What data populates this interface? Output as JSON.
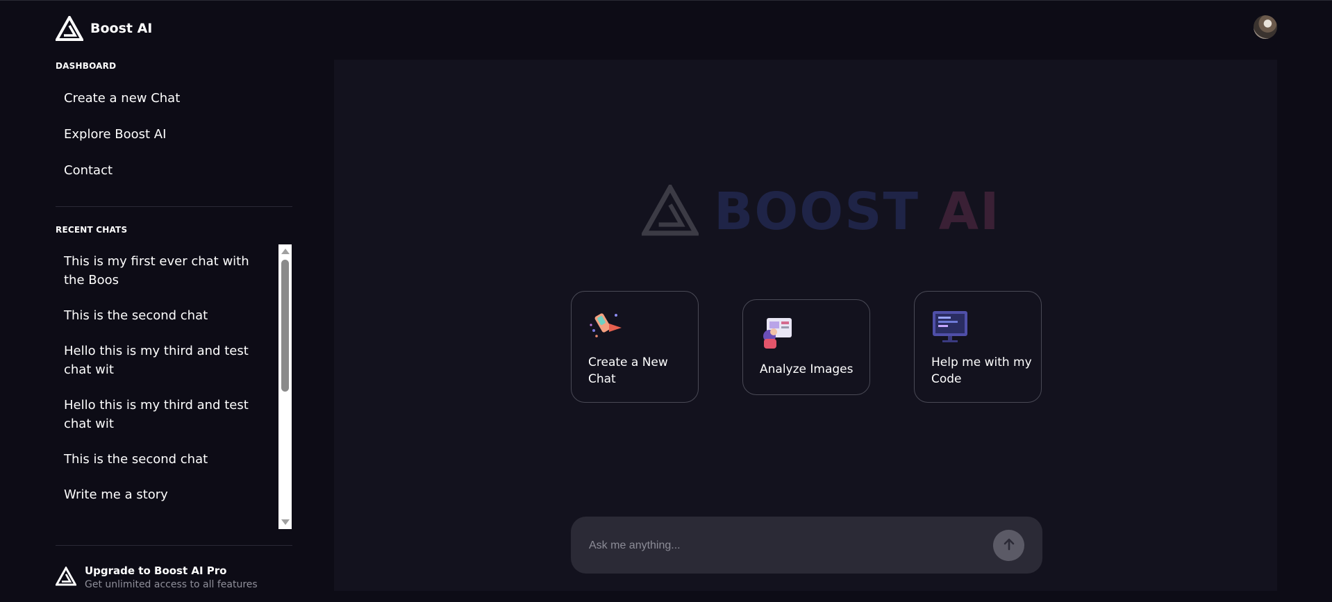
{
  "app": {
    "title": "Boost AI",
    "logo_icon": "triangle-logo-icon"
  },
  "header": {
    "avatar_icon": "user-avatar"
  },
  "sidebar": {
    "dashboard_title": "DASHBOARD",
    "nav": [
      {
        "label": "Create a new Chat"
      },
      {
        "label": "Explore Boost AI"
      },
      {
        "label": "Contact"
      }
    ],
    "recent_title": "RECENT CHATS",
    "recent": [
      {
        "label": "This is my first ever chat with the Boos"
      },
      {
        "label": "This is the second chat"
      },
      {
        "label": "Hello this is my third and test chat wit"
      },
      {
        "label": "Hello this is my third and test chat wit"
      },
      {
        "label": "This is the second chat"
      },
      {
        "label": "Write me a story"
      }
    ],
    "upgrade": {
      "title": "Upgrade to Boost AI Pro",
      "subtitle": "Get unlimited access to all features"
    }
  },
  "main": {
    "brand": {
      "word1": "BOOST",
      "word2": "AI"
    },
    "cards": [
      {
        "label": "Create a New Chat",
        "icon": "rocket-icon"
      },
      {
        "label": "Analyze Images",
        "icon": "image-analysis-icon"
      },
      {
        "label": "Help me with my Code",
        "icon": "code-monitor-icon"
      }
    ],
    "input": {
      "placeholder": "Ask me anything...",
      "value": ""
    },
    "send_icon": "arrow-up-icon"
  },
  "colors": {
    "background": "#0d0c16",
    "panel": "#13121e",
    "input_bg": "#2b2a36",
    "brand_boost": "#1f2447",
    "brand_ai": "#3a2035"
  }
}
